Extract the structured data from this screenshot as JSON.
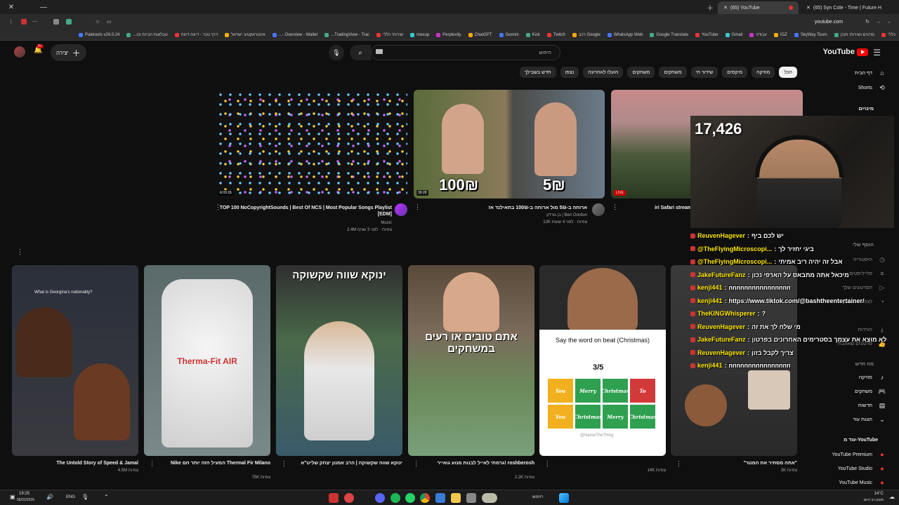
{
  "browser": {
    "tabs": [
      {
        "label": "(65) YouTube",
        "active": true
      },
      {
        "label": "(65) Syn Cole - Time | Future H",
        "active": false
      }
    ],
    "url": "youtube.com",
    "bookmarks": [
      "כללי",
      "סרטים ושירותי תוכן",
      "SkyWay Tours",
      "IGZ",
      "עבודה",
      "Gmail",
      "YouTube",
      "Google Translate",
      "WhatsApp Web",
      "Google רכב",
      "Twitch",
      "Kick",
      "Gemini",
      "ChatGPT",
      "Perplexity",
      "mexup",
      "שירותי כללי",
      "TradingView - Trac...",
      "Overview - Wallet -...",
      "אינטראקטיב ישראל",
      "דרך טכר - דיווח דיווח",
      "טבלאות הביות וכו...",
      "Paletools v26.0.24"
    ]
  },
  "header": {
    "logo": "YouTube",
    "search_placeholder": "חיפוש",
    "create_label": "יצירה",
    "notif_count": "9+"
  },
  "chips": [
    "הכל",
    "מוזיקה",
    "מיקסים",
    "שידור חי",
    "משחקים",
    "משחקים",
    "הועלו לאחרונה",
    "נצפו",
    "חדש בשבילך"
  ],
  "sidebar": {
    "top": [
      {
        "label": "דף הבית",
        "icon": "home-icon"
      },
      {
        "label": "Shorts",
        "icon": "shorts-icon"
      }
    ],
    "subs_label": "מינויים",
    "you_label": "הוסף שלי",
    "items": [
      {
        "label": "היסטוריה",
        "icon": "history-icon"
      },
      {
        "label": "פלייליסטים",
        "icon": "playlist-icon"
      },
      {
        "label": "הסרטונים שלך",
        "icon": "my-videos-icon"
      },
      {
        "label": "לצפייה בהמשך",
        "icon": "watch-later-icon"
      },
      {
        "label": "הורדות",
        "icon": "download-icon"
      },
      {
        "label": "סרטונים שאהבתי",
        "icon": "like-icon"
      }
    ],
    "explore_label": "מה חדש",
    "explore": [
      {
        "label": "מוזיקה",
        "icon": "music-icon"
      },
      {
        "label": "משחקים",
        "icon": "gaming-icon"
      },
      {
        "label": "חדשות",
        "icon": "news-icon"
      },
      {
        "label": "הצגת עוד",
        "icon": "chevron-down-icon"
      }
    ],
    "more_label": "עוד מ-YouTube",
    "more": [
      {
        "label": "YouTube Premium"
      },
      {
        "label": "YouTube Studio"
      },
      {
        "label": "YouTube Music"
      }
    ]
  },
  "row1": [
    {
      "title": "TOP 100 NoCopyrightSounds | Best Of NCS | Most Popular Songs Playlist [EDM]",
      "channel": "Music",
      "meta": "2.4M צפיות · לפני 3 שנים",
      "duration": "6:09:15"
    },
    {
      "title": "ארוחה ב-5₪ מול ארוחה ב-100₪ בתאילנד אז",
      "channel": "בן גורדון | Ben Gordon",
      "meta": "12K צפיות · לפני 4 שעות",
      "duration": "39:28",
      "price_left": "100₪",
      "price_right": "5₪"
    },
    {
      "title": "iri Safari stream",
      "channel": "",
      "meta": "",
      "live": "LIVE"
    }
  ],
  "row2": [
    {
      "title": "The Untold Story of Speed & Jamal",
      "meta": "4.5M צפיות",
      "overlay": "What is Georgina's nationality?"
    },
    {
      "title": "Nike המעיל הזה יותר חם Thermal Fir Milano",
      "meta": "75K צפיות",
      "overlay": "Therma-Fit AIR"
    },
    {
      "title": "ינוקא שווה שקשוקה | הרב אמנון יצחק שליט\"א",
      "meta": "",
      "overlay": "ינוקא שווה שקשוקה"
    },
    {
      "title": "גרמתי לאייל לבנות מנוע גואייר! roshberosh",
      "meta": "2.2K צפיות",
      "overlay": "אתם טובים או רעים במשחקים"
    },
    {
      "title": "",
      "meta": "14K צפיות",
      "overlay": "Say the word on beat (Christmas)",
      "score": "3/5",
      "bingo": [
        "You",
        "Merry",
        "Christmas",
        "To",
        "You",
        "Christmas",
        "Merry",
        "Christmas"
      ],
      "watermark": "@NameTheThing"
    },
    {
      "title": "\"אתה מסתיר את המטר\"",
      "meta": "3K צפיות",
      "overlay": ""
    }
  ],
  "webcam": {
    "viewers": "17,426"
  },
  "chat": [
    {
      "name": "ReuvenHagever",
      "msg": "יש לכם ביף"
    },
    {
      "name": "@TheFlyingMicroscopi...",
      "msg": "ביגי יחזיר לך"
    },
    {
      "name": "@TheFlyingMicroscopi...",
      "msg": "אבל זה יהיה ריב אמיתי"
    },
    {
      "name": "JakeFutureFanz",
      "msg": "מיכאל אתה מתבאס על הארפי נכון"
    },
    {
      "name": "kenji441",
      "msg": "nnnnnnnnnnnnnnnn"
    },
    {
      "name": "kenji441",
      "msg": "https://www.tiktok.com/@bashtheentertainer/"
    },
    {
      "name": "TheKINGWhisperer",
      "msg": "?"
    },
    {
      "name": "ReuvenHagever",
      "msg": "מי שלח לך את זה"
    },
    {
      "name": "JakeFutureFanz",
      "msg": "לא מוצא את עצמך בסטרימים האחרונים בפרטון"
    },
    {
      "name": "ReuvenHagever",
      "msg": "צריך לקבל בזון"
    },
    {
      "name": "kenji441",
      "msg": "nnnnnnnnnnnnnnnn"
    }
  ],
  "taskbar": {
    "time": "19:25",
    "date": "05/01/2026",
    "lang": "ENG",
    "search": "חיפוש",
    "weather": "14°C",
    "weather_text": "מעונן רב היום"
  }
}
